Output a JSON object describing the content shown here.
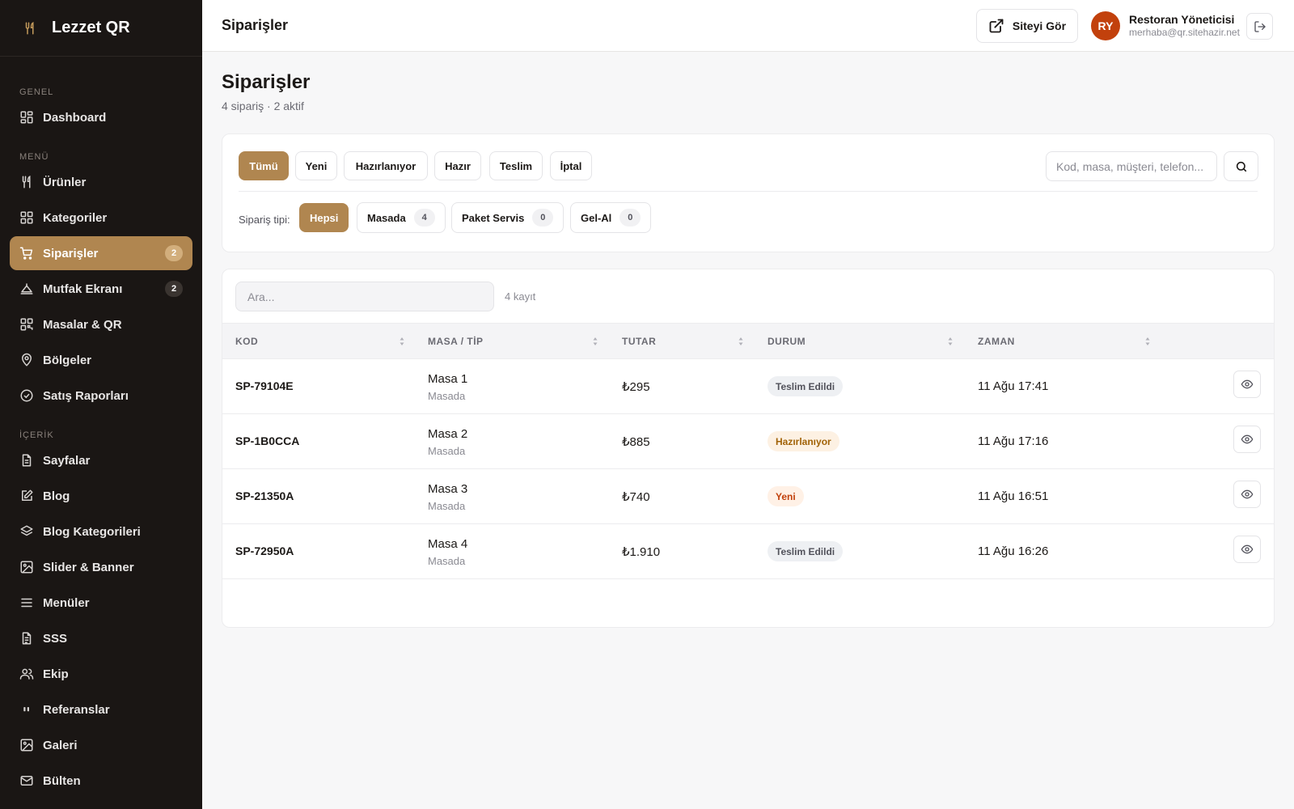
{
  "brand": {
    "name": "Lezzet QR",
    "icon": "utensils-icon"
  },
  "sidebar": {
    "sections": [
      {
        "title": "GENEL",
        "items": [
          {
            "label": "Dashboard",
            "icon": "grid-icon"
          }
        ]
      },
      {
        "title": "MENÜ",
        "items": [
          {
            "label": "Ürünler",
            "icon": "utensils-icon"
          },
          {
            "label": "Kategoriler",
            "icon": "grid-icon"
          },
          {
            "label": "Siparişler",
            "icon": "cart-icon",
            "badge": "2",
            "active": true
          },
          {
            "label": "Mutfak Ekranı",
            "icon": "chef-hat-icon",
            "badge": "2"
          },
          {
            "label": "Masalar & QR",
            "icon": "qr-icon"
          },
          {
            "label": "Bölgeler",
            "icon": "map-pin-icon"
          },
          {
            "label": "Satış Raporları",
            "icon": "check-circle-icon"
          }
        ]
      },
      {
        "title": "İÇERİK",
        "items": [
          {
            "label": "Sayfalar",
            "icon": "file-icon"
          },
          {
            "label": "Blog",
            "icon": "edit-icon"
          },
          {
            "label": "Blog Kategorileri",
            "icon": "layers-icon"
          },
          {
            "label": "Slider & Banner",
            "icon": "image-icon"
          },
          {
            "label": "Menüler",
            "icon": "menu-icon"
          },
          {
            "label": "SSS",
            "icon": "file-text-icon"
          },
          {
            "label": "Ekip",
            "icon": "users-icon"
          },
          {
            "label": "Referanslar",
            "icon": "quote-icon"
          },
          {
            "label": "Galeri",
            "icon": "image-icon"
          },
          {
            "label": "Bülten",
            "icon": "mail-icon"
          }
        ]
      }
    ]
  },
  "topbar": {
    "title": "Siparişler",
    "site_button": "Siteyi Gör",
    "user": {
      "initials": "RY",
      "name": "Restoran Yöneticisi",
      "email": "merhaba@qr.sitehazir.net"
    }
  },
  "page": {
    "title": "Siparişler",
    "subtitle": "4 sipariş · 2 aktif"
  },
  "filters": {
    "status": [
      "Tümü",
      "Yeni",
      "Hazırlanıyor",
      "Hazır",
      "Teslim",
      "İptal"
    ],
    "active_status": "Tümü",
    "search_placeholder": "Kod, masa, müşteri, telefon...",
    "type_label": "Sipariş tipi:",
    "types": [
      {
        "label": "Hepsi",
        "active": true
      },
      {
        "label": "Masada",
        "count": "4"
      },
      {
        "label": "Paket Servis",
        "count": "0"
      },
      {
        "label": "Gel-Al",
        "count": "0"
      }
    ]
  },
  "table": {
    "search_placeholder": "Ara...",
    "record_count": "4 kayıt",
    "columns": [
      "KOD",
      "MASA / TİP",
      "TUTAR",
      "DURUM",
      "ZAMAN"
    ],
    "rows": [
      {
        "code": "SP-79104E",
        "masa": "Masa 1",
        "tip": "Masada",
        "tutar": "₺295",
        "durum": "Teslim Edildi",
        "zaman": "11 Ağu 17:41"
      },
      {
        "code": "SP-1B0CCA",
        "masa": "Masa 2",
        "tip": "Masada",
        "tutar": "₺885",
        "durum": "Hazırlanıyor",
        "zaman": "11 Ağu 17:16"
      },
      {
        "code": "SP-21350A",
        "masa": "Masa 3",
        "tip": "Masada",
        "tutar": "₺740",
        "durum": "Yeni",
        "zaman": "11 Ağu 16:51"
      },
      {
        "code": "SP-72950A",
        "masa": "Masa 4",
        "tip": "Masada",
        "tutar": "₺1.910",
        "durum": "Teslim Edildi",
        "zaman": "11 Ağu 16:26"
      }
    ]
  },
  "colors": {
    "accent": "#b08650",
    "sidebar_bg": "#1a1614",
    "status_delivered_bg": "#eef0f3",
    "status_delivered_fg": "#52525b",
    "status_preparing_bg": "#fdf1e3",
    "status_preparing_fg": "#a16207",
    "status_new_bg": "#fff1e6",
    "status_new_fg": "#c2410c"
  }
}
